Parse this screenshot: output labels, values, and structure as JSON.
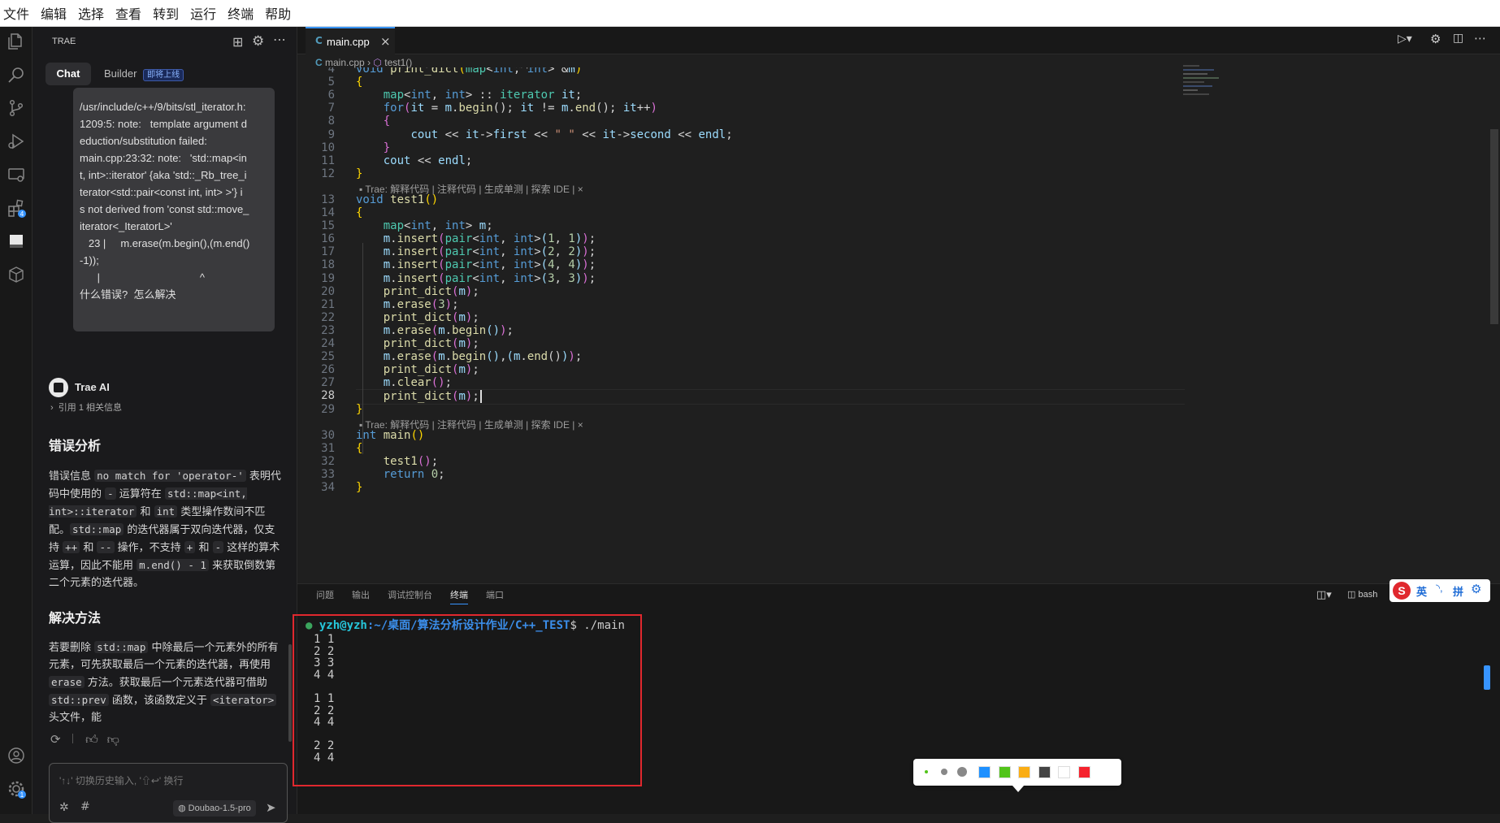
{
  "menu": [
    "文件",
    "编辑",
    "选择",
    "查看",
    "转到",
    "运行",
    "终端",
    "帮助"
  ],
  "sidebar": {
    "title": "TRAE",
    "tabs": {
      "chat": "Chat",
      "builder": "Builder",
      "builder_badge": "即将上线"
    },
    "user_message": {
      "lines": [
        "/usr/include/c++/9/bits/stl_iterator.h:",
        "1209:5: note:   template argument d",
        "eduction/substitution failed:",
        "main.cpp:23:32: note:   'std::map<in",
        "t, int>::iterator' {aka 'std::_Rb_tree_i",
        "terator<std::pair<const int, int> >'} i",
        "s not derived from 'const std::move_",
        "iterator<_IteratorL>'",
        "   23 |     m.erase(m.begin(),(m.end()",
        "-1));",
        "      |                                  ^",
        "什么错误?  怎么解决"
      ]
    },
    "ai": {
      "name": "Trae AI",
      "ref": "引用 1 相关信息",
      "h1": "错误分析",
      "p1": [
        {
          "t": "错误信息 "
        },
        {
          "c": "no match for 'operator-'"
        },
        {
          "t": " 表明代码中使用的 "
        },
        {
          "c": "-"
        },
        {
          "t": " 运算符在 "
        },
        {
          "c": "std::map<int, int>::iterator"
        },
        {
          "t": " 和 "
        },
        {
          "c": "int"
        },
        {
          "t": " 类型操作数间不匹配。"
        },
        {
          "c": "std::map"
        },
        {
          "t": " 的迭代器属于双向迭代器，仅支持 "
        },
        {
          "c": "++"
        },
        {
          "t": " 和 "
        },
        {
          "c": "--"
        },
        {
          "t": " 操作，不支持 "
        },
        {
          "c": "+"
        },
        {
          "t": " 和 "
        },
        {
          "c": "-"
        },
        {
          "t": " 这样的算术运算，因此不能用 "
        },
        {
          "c": "m.end() - 1"
        },
        {
          "t": " 来获取倒数第二个元素的迭代器。"
        }
      ],
      "h2": "解决方法",
      "p2": [
        {
          "t": "若要删除 "
        },
        {
          "c": "std::map"
        },
        {
          "t": " 中除最后一个元素外的所有元素，可先获取最后一个元素的迭代器，再使用 "
        },
        {
          "c": "erase"
        },
        {
          "t": " 方法。获取最后一个元素迭代器可借助 "
        },
        {
          "c": "std::prev"
        },
        {
          "t": " 函数，该函数定义于 "
        },
        {
          "c": "<iterator>"
        },
        {
          "t": " 头文件，能"
        }
      ]
    },
    "input": {
      "placeholder": "'↑↓' 切换历史输入, '⇧↩' 换行",
      "model": "Doubao-1.5-pro"
    }
  },
  "editor": {
    "tab": "main.cpp",
    "breadcrumb": [
      "main.cpp",
      "test1()"
    ],
    "codelens": "Trae: 解释代码 | 注释代码 | 生成单测 | 探索 IDE | ×",
    "codelens_top": "Trae: 解释代码 | 注释代码 | 生成单测 | 探索 IDE | ×",
    "lines": [
      {
        "n": "4",
        "html": "<span class='kw'>void</span> <span class='fn'>print_dict</span><span class='br'>(</span><span class='ty'>map</span><span class='pl'>&lt;</span><span class='kw'>int</span><span class='pl'>, </span><span class='kw'>int</span><span class='pl'>&gt; &amp;</span><span class='vr'>m</span><span class='br'>)</span>"
      },
      {
        "n": "5",
        "html": "<span class='br'>{</span>"
      },
      {
        "n": "6",
        "html": "    <span class='ty'>map</span><span class='pl'>&lt;</span><span class='kw'>int</span><span class='pl'>, </span><span class='kw'>int</span><span class='pl'>&gt; :: </span><span class='ty'>iterator</span><span class='pl'> </span><span class='vr'>it</span><span class='pl'>;</span>"
      },
      {
        "n": "7",
        "html": "    <span class='kw'>for</span><span class='br2'>(</span><span class='vr'>it</span><span class='pl'> = </span><span class='vr'>m</span><span class='pl'>.</span><span class='fn'>begin</span><span class='pl'>(); </span><span class='vr'>it</span><span class='pl'> != </span><span class='vr'>m</span><span class='pl'>.</span><span class='fn'>end</span><span class='pl'>(); </span><span class='vr'>it</span><span class='pl'>++</span><span class='br2'>)</span>"
      },
      {
        "n": "8",
        "html": "    <span class='br2'>{</span>"
      },
      {
        "n": "9",
        "html": "        <span class='vr'>cout</span><span class='pl'> &lt;&lt; </span><span class='vr'>it</span><span class='pl'>-&gt;</span><span class='vr'>first</span><span class='pl'> &lt;&lt; </span><span class='st'>\" \"</span><span class='pl'> &lt;&lt; </span><span class='vr'>it</span><span class='pl'>-&gt;</span><span class='vr'>second</span><span class='pl'> &lt;&lt; </span><span class='vr'>endl</span><span class='pl'>;</span>"
      },
      {
        "n": "10",
        "html": "    <span class='br2'>}</span>"
      },
      {
        "n": "11",
        "html": "    <span class='vr'>cout</span><span class='pl'> &lt;&lt; </span><span class='vr'>endl</span><span class='pl'>;</span>"
      },
      {
        "n": "12",
        "html": "<span class='br'>}</span>"
      },
      {
        "n": "13",
        "html": "<span class='kw'>void</span> <span class='fn'>test1</span><span class='br'>()</span>"
      },
      {
        "n": "14",
        "html": "<span class='br'>{</span>"
      },
      {
        "n": "15",
        "html": "    <span class='ty'>map</span><span class='pl'>&lt;</span><span class='kw'>int</span><span class='pl'>, </span><span class='kw'>int</span><span class='pl'>&gt; </span><span class='vr'>m</span><span class='pl'>;</span>"
      },
      {
        "n": "16",
        "html": "    <span class='vr'>m</span><span class='pl'>.</span><span class='fn'>insert</span><span class='br2'>(</span><span class='ty'>pair</span><span class='pl'>&lt;</span><span class='kw'>int</span><span class='pl'>, </span><span class='kw'>int</span><span class='pl'>&gt;</span><span class='vr'>(</span><span class='nm'>1</span><span class='pl'>, </span><span class='nm'>1</span><span class='vr'>)</span><span class='br2'>)</span><span class='pl'>;</span>"
      },
      {
        "n": "17",
        "html": "    <span class='vr'>m</span><span class='pl'>.</span><span class='fn'>insert</span><span class='br2'>(</span><span class='ty'>pair</span><span class='pl'>&lt;</span><span class='kw'>int</span><span class='pl'>, </span><span class='kw'>int</span><span class='pl'>&gt;</span><span class='vr'>(</span><span class='nm'>2</span><span class='pl'>, </span><span class='nm'>2</span><span class='vr'>)</span><span class='br2'>)</span><span class='pl'>;</span>"
      },
      {
        "n": "18",
        "html": "    <span class='vr'>m</span><span class='pl'>.</span><span class='fn'>insert</span><span class='br2'>(</span><span class='ty'>pair</span><span class='pl'>&lt;</span><span class='kw'>int</span><span class='pl'>, </span><span class='kw'>int</span><span class='pl'>&gt;</span><span class='vr'>(</span><span class='nm'>4</span><span class='pl'>, </span><span class='nm'>4</span><span class='vr'>)</span><span class='br2'>)</span><span class='pl'>;</span>"
      },
      {
        "n": "19",
        "html": "    <span class='vr'>m</span><span class='pl'>.</span><span class='fn'>insert</span><span class='br2'>(</span><span class='ty'>pair</span><span class='pl'>&lt;</span><span class='kw'>int</span><span class='pl'>, </span><span class='kw'>int</span><span class='pl'>&gt;</span><span class='vr'>(</span><span class='nm'>3</span><span class='pl'>, </span><span class='nm'>3</span><span class='vr'>)</span><span class='br2'>)</span><span class='pl'>;</span>"
      },
      {
        "n": "20",
        "html": "    <span class='fn'>print_dict</span><span class='br2'>(</span><span class='vr'>m</span><span class='br2'>)</span><span class='pl'>;</span>"
      },
      {
        "n": "21",
        "html": "    <span class='vr'>m</span><span class='pl'>.</span><span class='fn'>erase</span><span class='br2'>(</span><span class='nm'>3</span><span class='br2'>)</span><span class='pl'>;</span>"
      },
      {
        "n": "22",
        "html": "    <span class='fn'>print_dict</span><span class='br2'>(</span><span class='vr'>m</span><span class='br2'>)</span><span class='pl'>;</span>"
      },
      {
        "n": "23",
        "html": "    <span class='vr'>m</span><span class='pl'>.</span><span class='fn'>erase</span><span class='br2'>(</span><span class='vr'>m</span><span class='pl'>.</span><span class='fn'>begin</span><span class='vr'>()</span><span class='br2'>)</span><span class='pl'>;</span>"
      },
      {
        "n": "24",
        "html": "    <span class='fn'>print_dict</span><span class='br2'>(</span><span class='vr'>m</span><span class='br2'>)</span><span class='pl'>;</span>"
      },
      {
        "n": "25",
        "html": "    <span class='vr'>m</span><span class='pl'>.</span><span class='fn'>erase</span><span class='br2'>(</span><span class='vr'>m</span><span class='pl'>.</span><span class='fn'>begin</span><span class='vr'>()</span><span class='pl'>,</span><span class='vr'>(</span><span class='vr'>m</span><span class='pl'>.</span><span class='fn'>end</span><span class='pl'>()</span><span class='vr'>)</span><span class='br2'>)</span><span class='pl'>;</span>"
      },
      {
        "n": "26",
        "html": "    <span class='fn'>print_dict</span><span class='br2'>(</span><span class='vr'>m</span><span class='br2'>)</span><span class='pl'>;</span>"
      },
      {
        "n": "27",
        "html": "    <span class='vr'>m</span><span class='pl'>.</span><span class='fn'>clear</span><span class='br2'>()</span><span class='pl'>;</span>"
      },
      {
        "n": "28",
        "html": "    <span class='fn'>print_dict</span><span class='br2'>(</span><span class='vr'>m</span><span class='br2'>)</span><span class='pl'>;</span>"
      },
      {
        "n": "29",
        "html": "<span class='br'>}</span>"
      },
      {
        "n": "30",
        "html": "<span class='kw'>int</span> <span class='fn'>main</span><span class='br'>()</span>"
      },
      {
        "n": "31",
        "html": "<span class='br'>{</span>"
      },
      {
        "n": "32",
        "html": "    <span class='fn'>test1</span><span class='br2'>()</span><span class='pl'>;</span>"
      },
      {
        "n": "33",
        "html": "    <span class='kw'>return</span><span class='pl'> </span><span class='nm'>0</span><span class='pl'>;</span>"
      },
      {
        "n": "34",
        "html": "<span class='br'>}</span>"
      }
    ]
  },
  "panel": {
    "tabs": [
      "问题",
      "输出",
      "调试控制台",
      "终端",
      "端口"
    ],
    "active_tab": "终端",
    "shell": "bash",
    "prompt_user": "yzh@yzh",
    "prompt_path": ":~/桌面/算法分析设计作业/C++_TEST",
    "prompt_cmd": "$ ./main",
    "output": [
      "1 1",
      "2 2",
      "3 3",
      "4 4",
      "",
      "1 1",
      "2 2",
      "4 4",
      "",
      "2 2",
      "4 4"
    ]
  },
  "ime": {
    "lang": "英",
    "mode": "拼"
  },
  "palette": [
    "#1e90ff",
    "#52c41a",
    "#faad14",
    "#444444",
    "#ffffff",
    "#f5222d"
  ],
  "colors": {
    "highlight_box": "#e0282e",
    "accent": "#3794ff"
  }
}
